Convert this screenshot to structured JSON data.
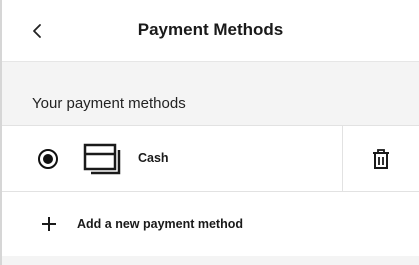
{
  "header": {
    "title": "Payment Methods",
    "back_icon": "chevron-left-icon"
  },
  "section": {
    "label": "Your payment methods"
  },
  "methods": [
    {
      "label": "Cash",
      "selected": true,
      "icon": "cash-card-icon",
      "delete_icon": "trash-icon"
    }
  ],
  "add_method": {
    "label": "Add a new payment method",
    "icon": "plus-icon"
  },
  "colors": {
    "text": "#1a1a1a",
    "band": "#f4f4f4",
    "divider": "#e2e2e2"
  }
}
